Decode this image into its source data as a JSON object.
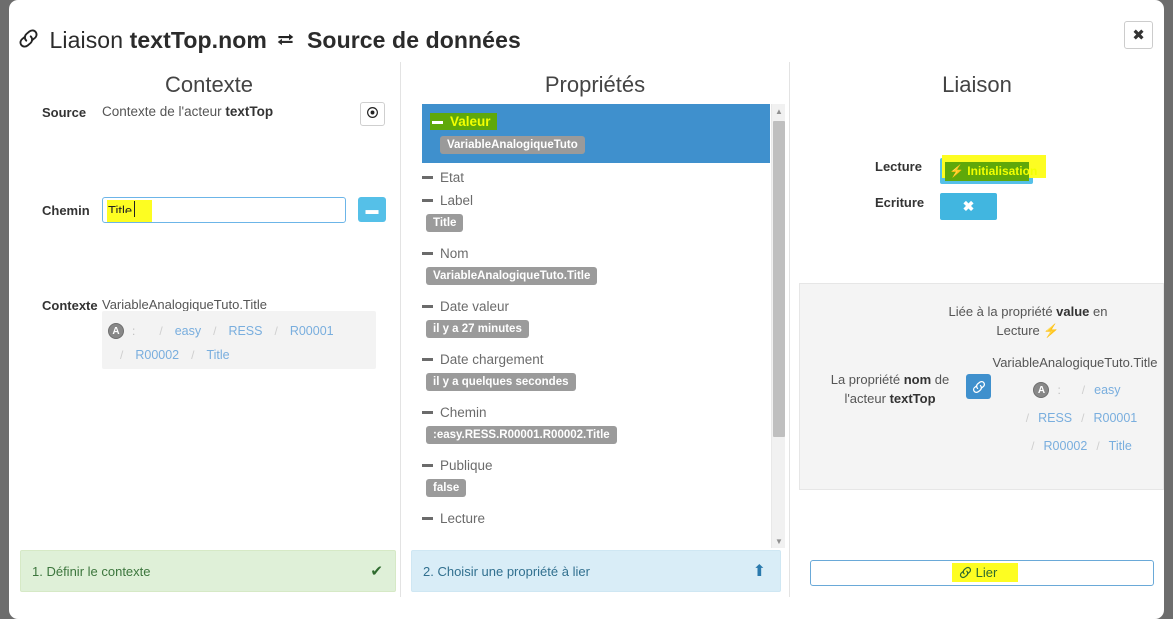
{
  "window": {
    "title_prefix": "Liaison",
    "title_target": "textTop.nom",
    "title_suffix": "Source de données",
    "link_icon": "link-icon",
    "exchange_icon": "exchange-arrows-icon",
    "close_label": "✖"
  },
  "columns": {
    "contexte": "Contexte",
    "proprietes": "Propriétés",
    "liaison": "Liaison"
  },
  "contexte": {
    "source_label": "Source",
    "source_value_prefix": "Contexte de l'acteur",
    "source_value_bold": "textTop",
    "target_icon": "◉",
    "chemin_label": "Chemin",
    "chemin_value": "Title",
    "chemin_placeholder": "",
    "dash_button_label": "▬",
    "contexte_label": "Contexte",
    "contexte_path": "VariableAnalogiqueTuto.Title",
    "breadcrumb": {
      "badge": "A",
      "colon": ":",
      "separator": "/",
      "row1": [
        "easy",
        "RESS",
        "R00001"
      ],
      "row2": [
        "R00002",
        "Title"
      ]
    }
  },
  "proprietes": {
    "items": [
      {
        "name": "Valeur",
        "value": "VariableAnalogiqueTuto",
        "selected": true,
        "highlighted": true
      },
      {
        "name": "Etat",
        "value": "",
        "selected": false,
        "highlighted": false
      },
      {
        "name": "Label",
        "value": "Title",
        "selected": false,
        "highlighted": false
      },
      {
        "name": "Nom",
        "value": "VariableAnalogiqueTuto.Title",
        "selected": false,
        "highlighted": false
      },
      {
        "name": "Date valeur",
        "value": "il y a 27 minutes",
        "selected": false,
        "highlighted": false
      },
      {
        "name": "Date chargement",
        "value": "il y a quelques secondes",
        "selected": false,
        "highlighted": false
      },
      {
        "name": "Chemin",
        "value": ":easy.RESS.R00001.R00002.Title",
        "selected": false,
        "highlighted": false
      },
      {
        "name": "Publique",
        "value": "false",
        "selected": false,
        "highlighted": false
      },
      {
        "name": "Lecture",
        "value": "",
        "selected": false,
        "highlighted": false
      }
    ],
    "scroll_up_icon": "▲",
    "scroll_down_icon": "▼"
  },
  "liaison": {
    "lecture_label": "Lecture",
    "ecriture_label": "Ecriture",
    "lecture_button": "⚡ Initialisation",
    "ecriture_button": "✖",
    "liee_line1_pre": "Liée à la propriété ",
    "liee_bold": "value",
    "liee_line1_post": " en",
    "liee_line2": "Lecture ⚡",
    "prop_line1_pre": "La propriété ",
    "prop_bold": "nom",
    "prop_line1_post": " de",
    "prop_line2_pre": "l'acteur ",
    "prop_line2_bold": "textTop",
    "link_icon": "🔗",
    "path": "VariableAnalogiqueTuto.Title",
    "breadcrumb": {
      "badge": "A",
      "colon": ":",
      "separator": "/",
      "row1": [
        "easy"
      ],
      "row2": [
        "RESS",
        "R00001"
      ],
      "row3": [
        "R00002",
        "Title"
      ]
    }
  },
  "footer": {
    "step1_label": "1. Définir le contexte",
    "step1_icon": "✔",
    "step2_label": "2. Choisir une propriété à lier",
    "step2_icon": "⬆",
    "lier_label": "Lier",
    "lier_icon": "link-icon"
  },
  "colors": {
    "accent_blue": "#3f90cd",
    "light_blue": "#55c0e8",
    "highlight_yellow": "#fdfd22",
    "highlight_green": "#5fa80a",
    "tag_grey": "#9b9b9b",
    "step_green_bg": "#dff0d8",
    "step_blue_bg": "#d9edf7"
  }
}
